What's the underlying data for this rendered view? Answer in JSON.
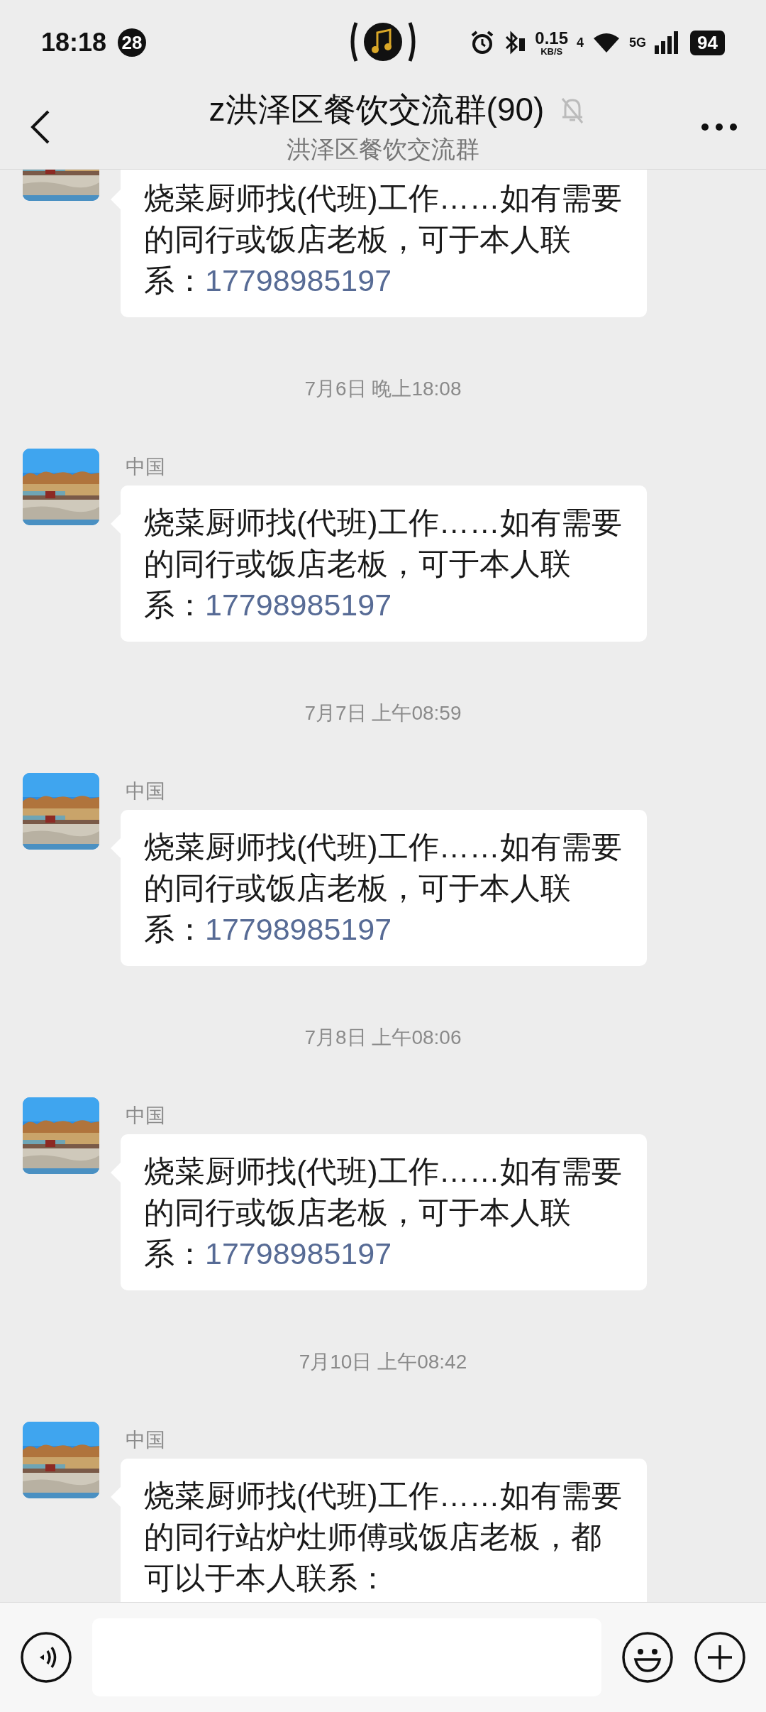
{
  "status_bar": {
    "time": "18:18",
    "notification_count": "28",
    "network_speed": "0.15",
    "speed_unit": "KB/S",
    "wifi_label": "4",
    "cell_label": "5G",
    "battery": "94"
  },
  "header": {
    "title": "z洪泽区餐饮交流群(90)",
    "subtitle": "洪泽区餐饮交流群",
    "muted": true
  },
  "messages": [
    {
      "kind": "message",
      "lines": [
        "烧菜厨师找(代班)工作……如有需要",
        "的同行或饭店老板，可于本人联",
        "系："
      ],
      "phone": "17798985197"
    },
    {
      "kind": "time",
      "text": "7月6日 晚上18:08"
    },
    {
      "kind": "message",
      "sender": "中国",
      "lines": [
        "烧菜厨师找(代班)工作……如有需要",
        "的同行或饭店老板，可于本人联",
        "系："
      ],
      "phone": "17798985197"
    },
    {
      "kind": "time",
      "text": "7月7日 上午08:59"
    },
    {
      "kind": "message",
      "sender": "中国",
      "lines": [
        "烧菜厨师找(代班)工作……如有需要",
        "的同行或饭店老板，可于本人联",
        "系："
      ],
      "phone": "17798985197"
    },
    {
      "kind": "time",
      "text": "7月8日 上午08:06"
    },
    {
      "kind": "message",
      "sender": "中国",
      "lines": [
        "烧菜厨师找(代班)工作……如有需要",
        "的同行或饭店老板，可于本人联",
        "系："
      ],
      "phone": "17798985197"
    },
    {
      "kind": "time",
      "text": "7月10日 上午08:42"
    },
    {
      "kind": "message",
      "sender": "中国",
      "lines": [
        "烧菜厨师找(代班)工作……如有需要",
        "的同行站炉灶师傅或饭店老板，都",
        "可以于本人联系："
      ]
    }
  ]
}
